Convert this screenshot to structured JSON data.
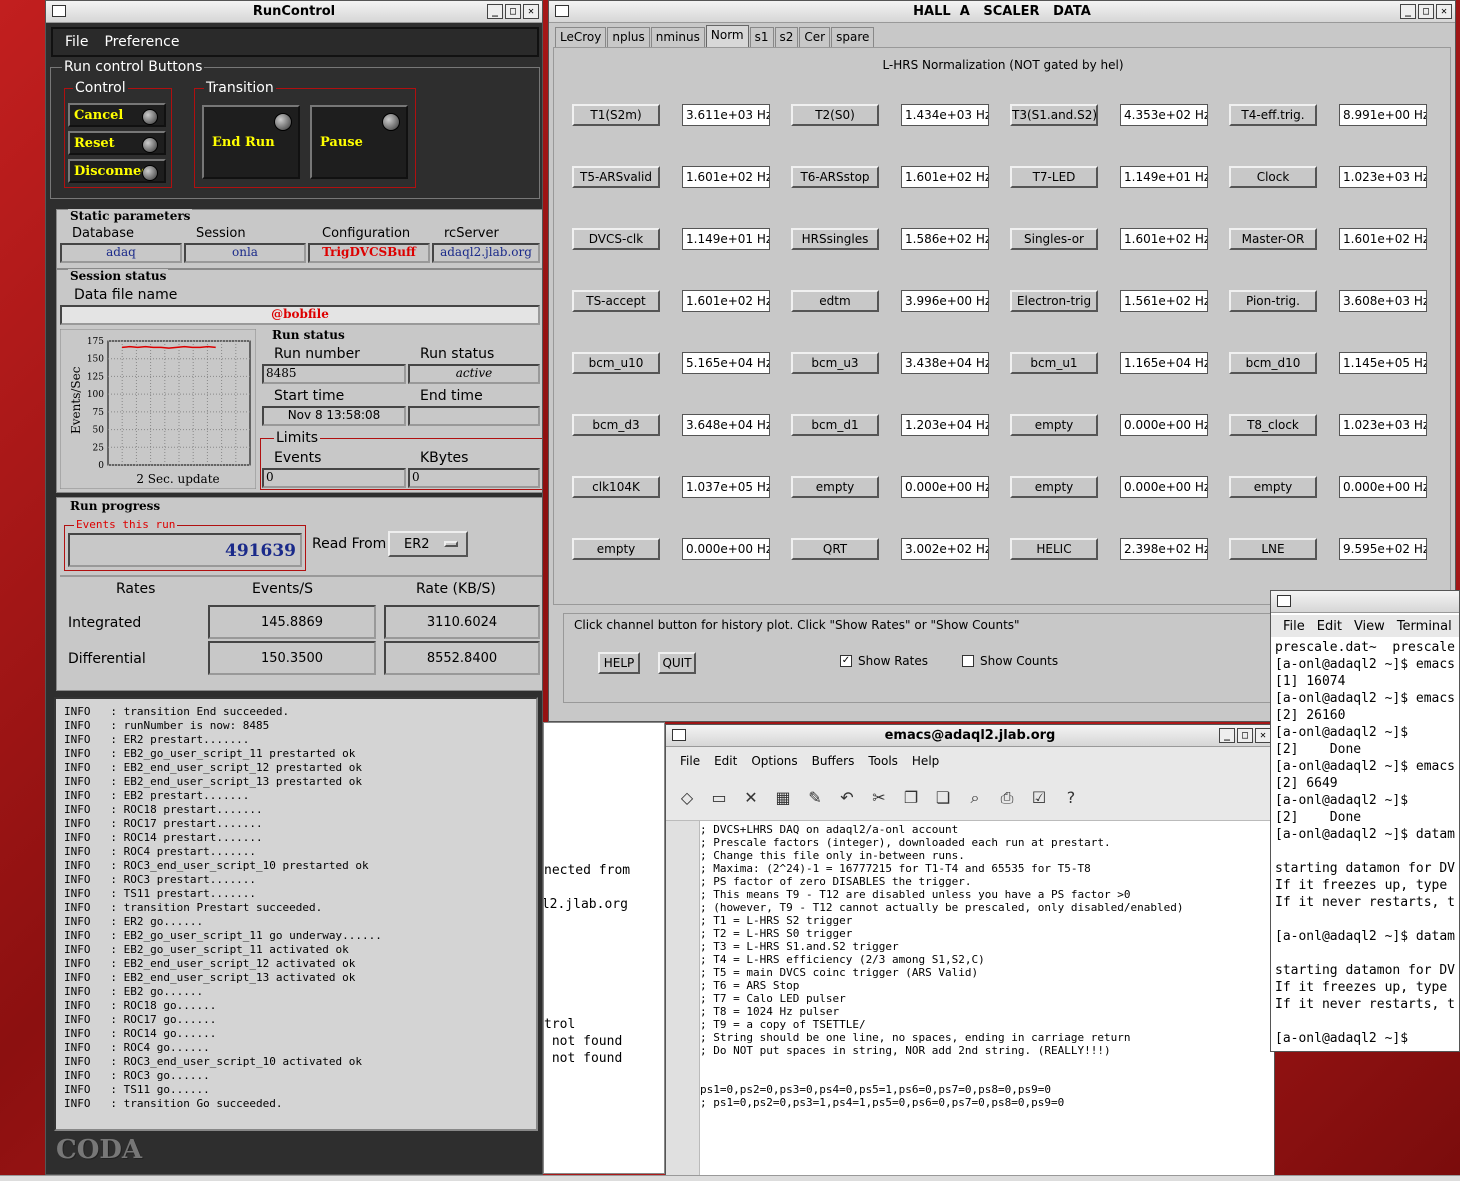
{
  "runcontrol": {
    "title": "RunControl",
    "menu": [
      "File",
      "Preference"
    ],
    "buttons_group_label": "Run control Buttons",
    "control_label": "Control",
    "transition_label": "Transition",
    "control_buttons": [
      "Cancel",
      "Reset",
      "Disconnect"
    ],
    "transition_buttons": [
      "End Run",
      "Pause"
    ],
    "static_label": "Static parameters",
    "static_fields": [
      {
        "label": "Database",
        "value": "adaq"
      },
      {
        "label": "Session",
        "value": "onla"
      },
      {
        "label": "Configuration",
        "value": "TrigDVCSBuff"
      },
      {
        "label": "rcServer",
        "value": "adaql2.jlab.org"
      }
    ],
    "session_status_label": "Session status",
    "data_file_label": "Data file name",
    "data_file_value": "@bobfile",
    "chart_caption": "2 Sec. update",
    "run_status_label": "Run status",
    "run_number_label": "Run number",
    "run_number_value": "8485",
    "run_status_field_label": "Run status",
    "run_status_value": "active",
    "start_time_label": "Start time",
    "start_time_value": "Nov 8 13:58:08",
    "end_time_label": "End time",
    "end_time_value": "",
    "limits_label": "Limits",
    "events_label": "Events",
    "events_value": "0",
    "kbytes_label": "KBytes",
    "kbytes_value": "0",
    "run_progress_label": "Run progress",
    "events_this_run_label": "Events this run",
    "events_this_run_value": "491639",
    "read_from_label": "Read From:",
    "read_from_value": "ER2",
    "rates_headers": [
      "Rates",
      "Events/S",
      "Rate (KB/S)"
    ],
    "rates_rows": [
      {
        "label": "Integrated",
        "events": "145.8869",
        "rate": "3110.6024"
      },
      {
        "label": "Differential",
        "events": "150.3500",
        "rate": "8552.8400"
      }
    ],
    "log_lines": [
      "INFO   : transition End succeeded.",
      "INFO   : runNumber is now: 8485",
      "INFO   : ER2 prestart.......",
      "INFO   : EB2_go_user_script_11 prestarted ok",
      "INFO   : EB2_end_user_script_12 prestarted ok",
      "INFO   : EB2_end_user_script_13 prestarted ok",
      "INFO   : EB2 prestart.......",
      "INFO   : ROC18 prestart.......",
      "INFO   : ROC17 prestart.......",
      "INFO   : ROC14 prestart.......",
      "INFO   : ROC4 prestart.......",
      "INFO   : ROC3_end_user_script_10 prestarted ok",
      "INFO   : ROC3 prestart.......",
      "INFO   : TS11 prestart.......",
      "INFO   : transition Prestart succeeded.",
      "INFO   : ER2 go......",
      "INFO   : EB2_go_user_script_11 go underway......",
      "INFO   : EB2_go_user_script_11 activated ok",
      "INFO   : EB2_end_user_script_12 activated ok",
      "INFO   : EB2_end_user_script_13 activated ok",
      "INFO   : EB2 go......",
      "INFO   : ROC18 go......",
      "INFO   : ROC17 go......",
      "INFO   : ROC14 go......",
      "INFO   : ROC4 go......",
      "INFO   : ROC3_end_user_script_10 activated ok",
      "INFO   : ROC3 go......",
      "INFO   : TS11 go......",
      "INFO   : transition Go succeeded."
    ],
    "logo": "CODA"
  },
  "chart_data": {
    "type": "line",
    "title": "",
    "xlabel": "2 Sec. update",
    "ylabel": "Events/Sec",
    "ylim": [
      0,
      175
    ],
    "yticks": [
      0,
      25,
      50,
      75,
      100,
      125,
      150,
      175
    ],
    "grid": true,
    "series": [
      {
        "values": [
          166,
          167,
          166,
          167,
          166,
          166,
          165,
          166,
          167,
          166,
          166,
          167,
          166
        ]
      }
    ],
    "line_color": "#dd0000"
  },
  "scaler": {
    "title": "HALL  A   SCALER   DATA",
    "tabs": [
      "LeCroy",
      "nplus",
      "nminus",
      "Norm",
      "s1",
      "s2",
      "Cer",
      "spare"
    ],
    "active_tab": "Norm",
    "heading": "L-HRS Normalization (NOT gated by hel)",
    "channels": [
      [
        "T1(S2m)",
        "3.611e+03 Hz",
        "T2(S0)",
        "1.434e+03 Hz",
        "T3(S1.and.S2)",
        "4.353e+02 Hz",
        "T4-eff.trig.",
        "8.991e+00 Hz"
      ],
      [
        "T5-ARSvalid",
        "1.601e+02 Hz",
        "T6-ARSstop",
        "1.601e+02 Hz",
        "T7-LED",
        "1.149e+01 Hz",
        "Clock",
        "1.023e+03 Hz"
      ],
      [
        "DVCS-clk",
        "1.149e+01 Hz",
        "HRSsingles",
        "1.586e+02 Hz",
        "Singles-or",
        "1.601e+02 Hz",
        "Master-OR",
        "1.601e+02 Hz"
      ],
      [
        "TS-accept",
        "1.601e+02 Hz",
        "edtm",
        "3.996e+00 Hz",
        "Electron-trig",
        "1.561e+02 Hz",
        "Pion-trig.",
        "3.608e+03 Hz"
      ],
      [
        "bcm_u10",
        "5.165e+04 Hz",
        "bcm_u3",
        "3.438e+04 Hz",
        "bcm_u1",
        "1.165e+04 Hz",
        "bcm_d10",
        "1.145e+05 Hz"
      ],
      [
        "bcm_d3",
        "3.648e+04 Hz",
        "bcm_d1",
        "1.203e+04 Hz",
        "empty",
        "0.000e+00 Hz",
        "T8_clock",
        "1.023e+03 Hz"
      ],
      [
        "clk104K",
        "1.037e+05 Hz",
        "empty",
        "0.000e+00 Hz",
        "empty",
        "0.000e+00 Hz",
        "empty",
        "0.000e+00 Hz"
      ],
      [
        "empty",
        "0.000e+00 Hz",
        "QRT",
        "3.002e+02 Hz",
        "HELIC",
        "2.398e+02 Hz",
        "LNE",
        "9.595e+02 Hz"
      ]
    ],
    "help_text": "Click channel button for history plot.  Click \"Show Rates\" or \"Show Counts\"",
    "help_button": "HELP",
    "quit_button": "QUIT",
    "show_rates_label": "Show Rates",
    "show_counts_label": "Show Counts",
    "show_rates_checked": true
  },
  "emacs": {
    "title": "emacs@adaql2.jlab.org",
    "menu": [
      "File",
      "Edit",
      "Options",
      "Buffers",
      "Tools",
      "Help"
    ],
    "lines": [
      "; DVCS+LHRS DAQ on adaql2/a-onl account",
      "; Prescale factors (integer), downloaded each run at prestart.",
      "; Change this file only in-between runs.",
      "; Maxima: (2^24)-1 = 16777215 for T1-T4 and 65535 for T5-T8",
      "; PS factor of zero DISABLES the trigger.",
      "; This means T9 - T12 are disabled unless you have a PS factor >0",
      "; (however, T9 - T12 cannot actually be prescaled, only disabled/enabled)",
      "; T1 = L-HRS S2 trigger",
      "; T2 = L-HRS S0 trigger",
      "; T3 = L-HRS S1.and.S2 trigger",
      "; T4 = L-HRS efficiency (2/3 among S1,S2,C)",
      "; T5 = main DVCS coinc trigger (ARS Valid)",
      "; T6 = ARS Stop",
      "; T7 = Calo LED pulser",
      "; T8 = 1024 Hz pulser",
      "; T9 = a copy of TSETTLE/",
      "; String should be one line, no spaces, ending in carriage return",
      "; Do NOT put spaces in string, NOR add 2nd string. (REALLY!!!)",
      "",
      "",
      "ps1=0,ps2=0,ps3=0,ps4=0,ps5=1,ps6=0,ps7=0,ps8=0,ps9=0",
      "; ps1=0,ps2=0,ps3=1,ps4=1,ps5=0,ps6=0,ps7=0,ps8=0,ps9=0"
    ]
  },
  "terminal": {
    "menu": [
      "File",
      "Edit",
      "View",
      "Terminal"
    ],
    "lines": [
      "prescale.dat~  prescale",
      "[a-onl@adaql2 ~]$ emacs",
      "[1] 16074",
      "[a-onl@adaql2 ~]$ emacs",
      "[2] 26160",
      "[a-onl@adaql2 ~]$",
      "[2]    Done",
      "[a-onl@adaql2 ~]$ emacs",
      "[2] 6649",
      "[a-onl@adaql2 ~]$",
      "[2]    Done",
      "[a-onl@adaql2 ~]$ datam",
      "",
      "starting datamon for DV",
      "If it freezes up, type",
      "If it never restarts, t",
      "",
      "[a-onl@adaql2 ~]$ datam",
      "",
      "starting datamon for DV",
      "If it freezes up, type",
      "If it never restarts, t",
      "",
      "[a-onl@adaql2 ~]$ "
    ]
  },
  "bg_terminal": {
    "line1": "nected from",
    "line2": "ql2.jlab.org",
    "line3": "trol",
    "line4": " not found",
    "line5": " not found"
  }
}
